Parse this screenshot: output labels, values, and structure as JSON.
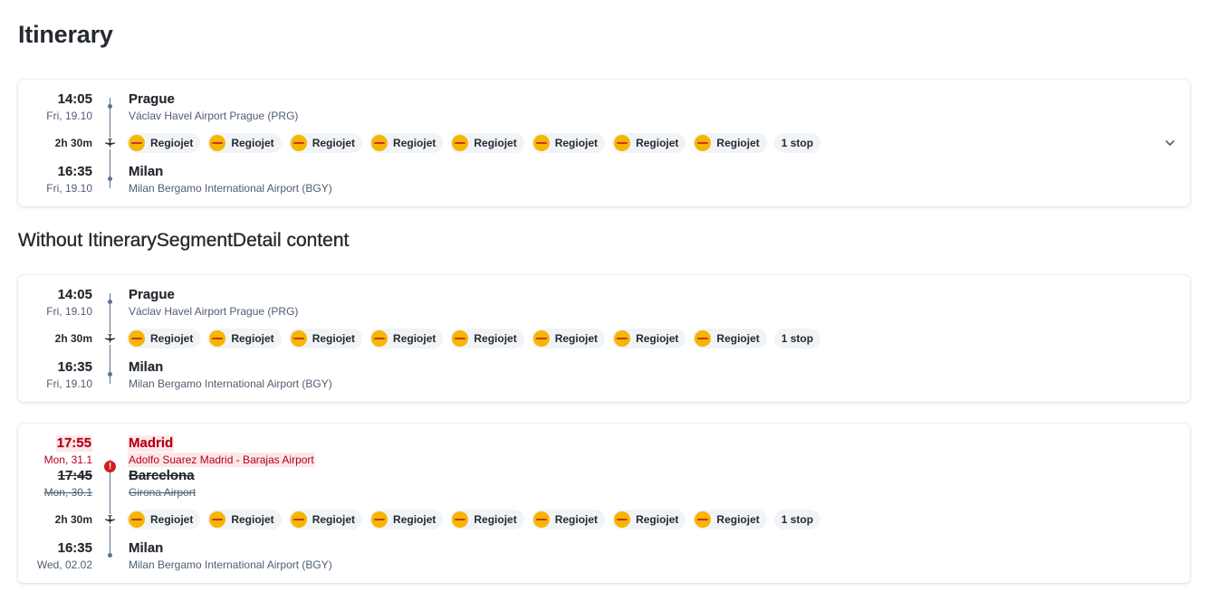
{
  "page_title": "Itinerary",
  "section_title": "Without ItinerarySegmentDetail content",
  "segments": [
    {
      "departure": {
        "time": "14:05",
        "date": "Fri, 19.10",
        "city": "Prague",
        "airport": "Václav Havel Airport Prague (PRG)"
      },
      "duration": "2h 30m",
      "carriers": [
        "Regiojet",
        "Regiojet",
        "Regiojet",
        "Regiojet",
        "Regiojet",
        "Regiojet",
        "Regiojet",
        "Regiojet"
      ],
      "stops": "1 stop",
      "arrival": {
        "time": "16:35",
        "date": "Fri, 19.10",
        "city": "Milan",
        "airport": "Milan Bergamo International Airport (BGY)"
      },
      "expand_icon": "chevron-down-icon"
    },
    {
      "departure": {
        "time": "14:05",
        "date": "Fri, 19.10",
        "city": "Prague",
        "airport": "Václav Havel Airport Prague (PRG)"
      },
      "duration": "2h 30m",
      "carriers": [
        "Regiojet",
        "Regiojet",
        "Regiojet",
        "Regiojet",
        "Regiojet",
        "Regiojet",
        "Regiojet",
        "Regiojet"
      ],
      "stops": "1 stop",
      "arrival": {
        "time": "16:35",
        "date": "Fri, 19.10",
        "city": "Milan",
        "airport": "Milan Bergamo International Airport (BGY)"
      }
    },
    {
      "changed_departure": {
        "time": "17:55",
        "date": "Mon, 31.1",
        "city": "Madrid",
        "airport": "Adolfo Suarez Madrid - Barajas Airport"
      },
      "departure": {
        "time": "17:45",
        "date": "Mon, 30.1",
        "city": "Barcelona",
        "airport": "Girona Airport"
      },
      "duration": "2h 30m",
      "carriers": [
        "Regiojet",
        "Regiojet",
        "Regiojet",
        "Regiojet",
        "Regiojet",
        "Regiojet",
        "Regiojet",
        "Regiojet"
      ],
      "stops": "1 stop",
      "arrival": {
        "time": "16:35",
        "date": "Wed, 02.02",
        "city": "Milan",
        "airport": "Milan Bergamo International Airport (BGY)"
      },
      "alert_icon": "alert-circle-icon",
      "alert_glyph": "!"
    }
  ],
  "colors": {
    "text_primary": "#252a31",
    "text_secondary": "#4f5e71",
    "timeline": "#5f738c",
    "critical": "#d21c1c",
    "critical_background": "#fde8e8",
    "carrier_logo": "#f7b500",
    "badge_background": "#f1f4f7"
  }
}
